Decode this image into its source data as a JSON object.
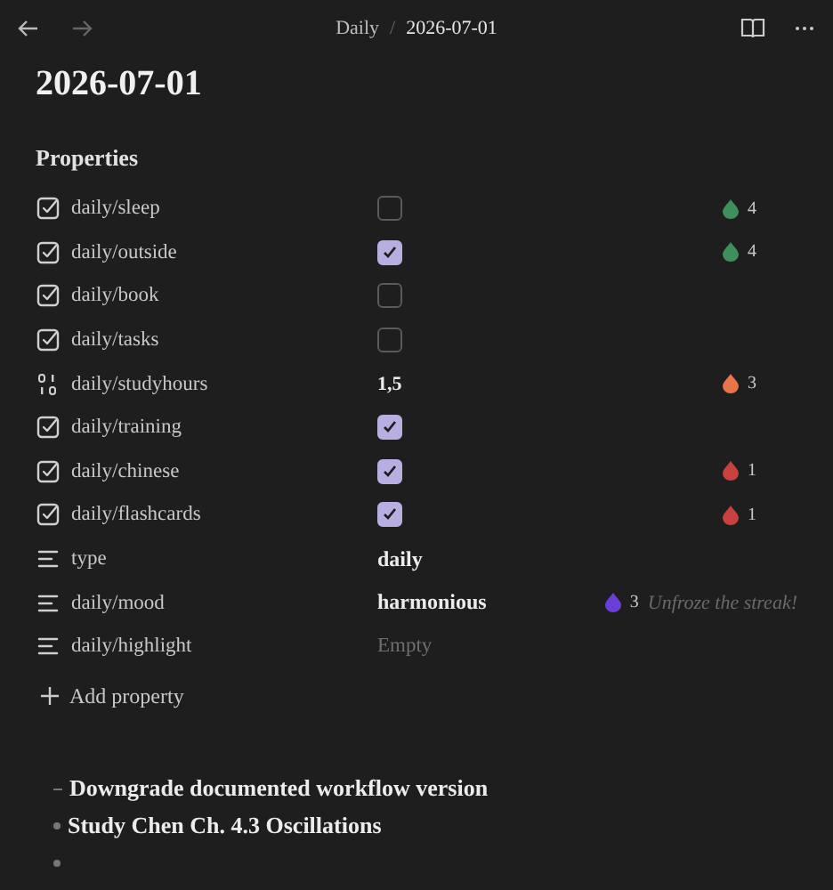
{
  "breadcrumb": {
    "parent": "Daily",
    "separator": "/",
    "current": "2026-07-01"
  },
  "title": "2026-07-01",
  "properties_heading": "Properties",
  "properties": [
    {
      "kind": "checkbox",
      "name": "daily/sleep",
      "checked": false,
      "badge": {
        "color": "#3f8f5a",
        "count": "4"
      }
    },
    {
      "kind": "checkbox",
      "name": "daily/outside",
      "checked": true,
      "badge": {
        "color": "#3f8f5a",
        "count": "4"
      }
    },
    {
      "kind": "checkbox",
      "name": "daily/book",
      "checked": false
    },
    {
      "kind": "checkbox",
      "name": "daily/tasks",
      "checked": false
    },
    {
      "kind": "number",
      "name": "daily/studyhours",
      "value": "1,5",
      "badge": {
        "color": "#e8744a",
        "count": "3"
      }
    },
    {
      "kind": "checkbox",
      "name": "daily/training",
      "checked": true
    },
    {
      "kind": "checkbox",
      "name": "daily/chinese",
      "checked": true,
      "badge": {
        "color": "#c8413c",
        "count": "1"
      }
    },
    {
      "kind": "checkbox",
      "name": "daily/flashcards",
      "checked": true,
      "badge": {
        "color": "#c8413c",
        "count": "1"
      }
    },
    {
      "kind": "text",
      "name": "type",
      "value": "daily"
    },
    {
      "kind": "text",
      "name": "daily/mood",
      "value": "harmonious",
      "badge": {
        "color": "#6a3fd8",
        "count": "3",
        "note": "Unfroze the streak!"
      }
    },
    {
      "kind": "text",
      "name": "daily/highlight",
      "placeholder": "Empty"
    }
  ],
  "add_property": "Add property",
  "list": [
    {
      "kind": "dash",
      "text": "Downgrade documented workflow version"
    },
    {
      "kind": "bullet",
      "text": "Study Chen Ch. 4.3 Oscillations"
    },
    {
      "kind": "bullet"
    }
  ]
}
